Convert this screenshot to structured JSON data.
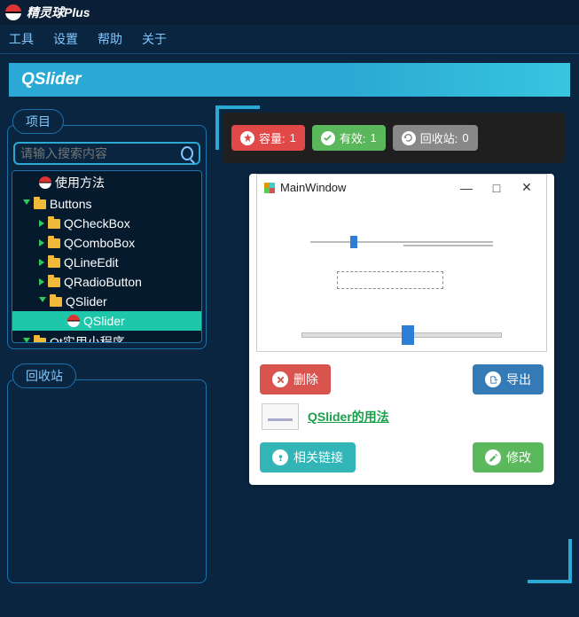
{
  "app_title": "精灵球Plus",
  "menu": {
    "tools": "工具",
    "settings": "设置",
    "help": "帮助",
    "about": "关于"
  },
  "page_title": "QSlider",
  "sidebar": {
    "project_label": "项目",
    "recycle_label": "回收站",
    "search_placeholder": "请输入搜索内容",
    "tree": {
      "usage": "使用方法",
      "buttons": "Buttons",
      "qcheckbox": "QCheckBox",
      "qcombobox": "QComboBox",
      "qlineedit": "QLineEdit",
      "qradio": "QRadioButton",
      "qslider_folder": "QSlider",
      "qslider_item": "QSlider",
      "util": "Qt实用小程序"
    }
  },
  "badges": {
    "capacity_label": "容量:",
    "capacity_value": "1",
    "valid_label": "有效:",
    "valid_value": "1",
    "recycle_label": "回收站:",
    "recycle_value": "0"
  },
  "preview": {
    "window_title": "MainWindow"
  },
  "actions": {
    "delete": "删除",
    "export": "导出",
    "related": "相关链接",
    "edit": "修改"
  },
  "link": {
    "label": "QSlider的用法"
  }
}
